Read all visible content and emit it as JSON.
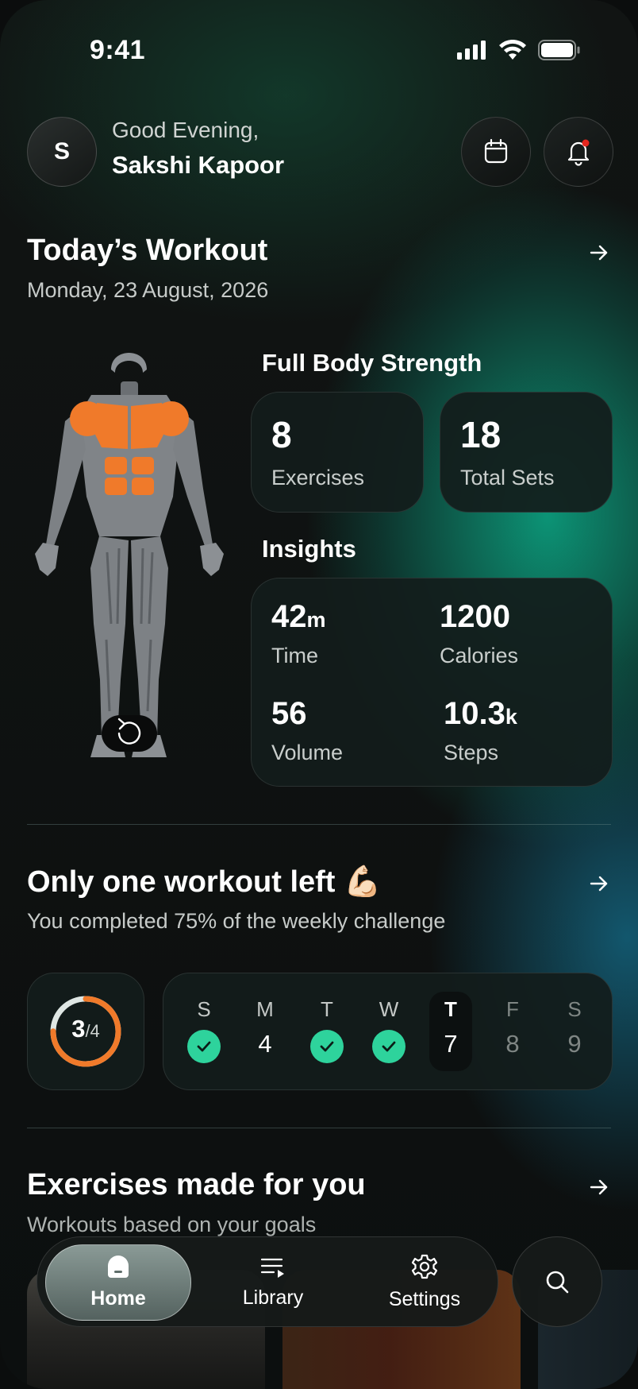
{
  "status_bar": {
    "time": "9:41"
  },
  "header": {
    "avatar_initial": "S",
    "greeting": "Good Evening,",
    "user_name": "Sakshi Kapoor",
    "icons": [
      "calendar-icon",
      "bell-icon"
    ],
    "notification_dot_color": "#e5271f"
  },
  "todays_workout": {
    "title": "Today’s Workout",
    "date": "Monday, 23 August, 2026",
    "program_name": "Full Body Strength",
    "stats": [
      {
        "value": "8",
        "label": "Exercises"
      },
      {
        "value": "18",
        "label": "Total Sets"
      }
    ],
    "insights_title": "Insights",
    "insights": [
      {
        "value": "42",
        "unit": "m",
        "label": "Time"
      },
      {
        "value": "1200",
        "unit": "",
        "label": "Calories"
      },
      {
        "value": "56",
        "unit": "",
        "label": "Volume"
      },
      {
        "value": "10.3",
        "unit": "k",
        "label": "Steps"
      }
    ],
    "highlight_color": "#f07a2a"
  },
  "weekly_challenge": {
    "title": "Only one workout left 💪🏻",
    "subtitle": "You completed 75% of the weekly challenge",
    "progress_done": "3",
    "progress_total": "/4",
    "progress_fraction": 0.75,
    "progress_color": "#f07a2a",
    "days": [
      {
        "letter": "S",
        "num": "",
        "done": true
      },
      {
        "letter": "M",
        "num": "4",
        "done": false
      },
      {
        "letter": "T",
        "num": "",
        "done": true
      },
      {
        "letter": "W",
        "num": "",
        "done": true
      },
      {
        "letter": "T",
        "num": "7",
        "done": false,
        "today": true
      },
      {
        "letter": "F",
        "num": "8",
        "done": false,
        "future": true
      },
      {
        "letter": "S",
        "num": "9",
        "done": false,
        "future": true
      }
    ],
    "check_color": "#2ed39c"
  },
  "exercises": {
    "title": "Exercises made for you",
    "subtitle": "Workouts based on your goals"
  },
  "bottom_nav": {
    "items": [
      {
        "label": "Home",
        "icon": "home-icon",
        "active": true
      },
      {
        "label": "Library",
        "icon": "library-icon",
        "active": false
      },
      {
        "label": "Settings",
        "icon": "gear-icon",
        "active": false
      }
    ],
    "search_icon": "search-icon"
  }
}
